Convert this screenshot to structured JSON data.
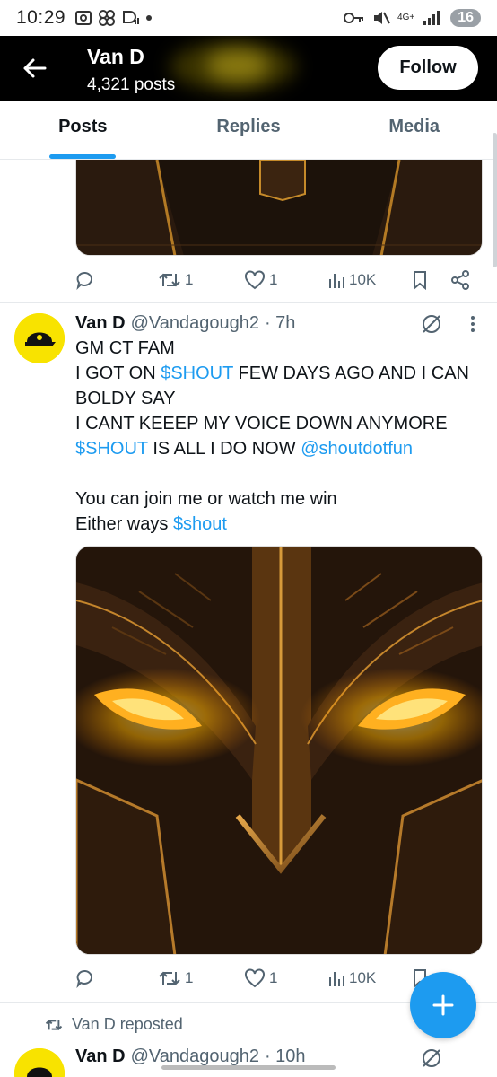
{
  "status_bar": {
    "time": "10:29",
    "network": "4G+",
    "battery": "16",
    "icons": [
      "screenshot-icon",
      "pinwheel-icon",
      "data-icon",
      "dot-icon",
      "key-icon",
      "mute-icon",
      "signal-icon"
    ]
  },
  "header": {
    "title": "Van D",
    "posts_count": "4,321 posts",
    "follow_label": "Follow",
    "back_icon": "back-arrow-icon"
  },
  "tabs": [
    {
      "label": "Posts",
      "active": true
    },
    {
      "label": "Replies",
      "active": false
    },
    {
      "label": "Media",
      "active": false
    }
  ],
  "prev_post_actions": {
    "replies": "",
    "reposts": "1",
    "likes": "1",
    "views": "10K"
  },
  "tweet": {
    "name": "Van D",
    "handle": "@Vandagough2",
    "time": "· 7h",
    "lines": [
      [
        "GM CT FAM"
      ],
      [
        "I GOT ON ",
        {
          "link": "$SHOUT"
        },
        " FEW DAYS AGO AND I CAN"
      ],
      [
        "BOLDY SAY"
      ],
      [
        "I CANT KEEEP MY VOICE DOWN ANYMORE"
      ],
      [
        {
          "link": "$SHOUT"
        },
        " IS ALL I DO NOW ",
        {
          "link": "@shoutdotfun"
        }
      ],
      [
        ""
      ],
      [
        "You can join me or watch me win"
      ],
      [
        "Either ways ",
        {
          "link": "$shout"
        }
      ]
    ],
    "actions": {
      "reposts": "1",
      "likes": "1",
      "views": "10K"
    }
  },
  "repost_notice": "Van D reposted",
  "next_tweet": {
    "name": "Van D",
    "handle": "@Vandagough2",
    "time": "· 10h"
  },
  "colors": {
    "accent": "#1d9bf0",
    "text": "#0f1419",
    "muted": "#536471",
    "avatar_bg": "#f8e300"
  }
}
